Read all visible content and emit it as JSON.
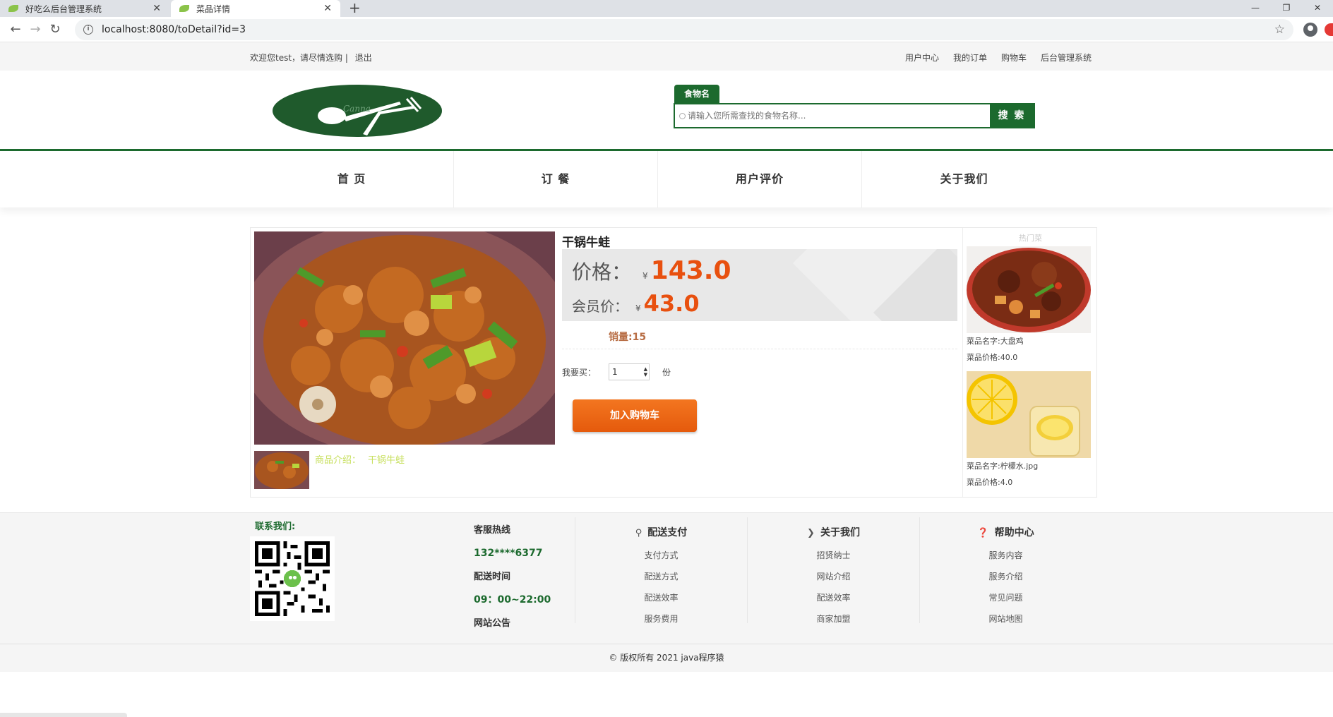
{
  "browser": {
    "tabs": [
      {
        "title": "好吃么后台管理系统",
        "active": false
      },
      {
        "title": "菜品详情",
        "active": true
      }
    ],
    "url": "localhost:8080/toDetail?id=3"
  },
  "topbar": {
    "welcome": "欢迎您test，请尽情选购 |",
    "logout": "退出",
    "links": [
      "用户中心",
      "我的订单",
      "购物车",
      "后台管理系统"
    ]
  },
  "search": {
    "tab_label": "食物名",
    "placeholder": "请输入您所需查找的食物名称...",
    "button": "搜 索"
  },
  "nav": [
    "首 页",
    "订 餐",
    "用户评价",
    "关于我们"
  ],
  "product": {
    "name": "干锅牛蛙",
    "price_label": "价格：",
    "currency": "¥",
    "price": "143.0",
    "member_label": "会员价：",
    "member_price": "43.0",
    "sales": "销量:15",
    "buy_label": "我要买：",
    "quantity": "1",
    "unit": "份",
    "add_to_cart": "加入购物车",
    "intro_label": "商品介绍：",
    "intro_text": "干锅牛蛙"
  },
  "hot": {
    "title": "热门菜",
    "items": [
      {
        "name": "菜品名字:大盘鸡",
        "price": "菜品价格:40.0"
      },
      {
        "name": "菜品名字:柠檬水.jpg",
        "price": "菜品价格:4.0"
      }
    ]
  },
  "footer": {
    "contact_title": "联系我们:",
    "hotline_label": "客服热线",
    "hotline": "132****6377",
    "time_label": "配送时间",
    "time": "09：00~22:00",
    "notice": "网站公告",
    "columns": [
      {
        "title": "配送支付",
        "icon": "bicycle-icon",
        "links": [
          "支付方式",
          "配送方式",
          "配送效率",
          "服务费用"
        ]
      },
      {
        "title": "关于我们",
        "icon": "chevron-down-icon",
        "links": [
          "招贤纳士",
          "网站介绍",
          "配送效率",
          "商家加盟"
        ]
      },
      {
        "title": "帮助中心",
        "icon": "help-icon",
        "links": [
          "服务内容",
          "服务介绍",
          "常见问题",
          "网站地图"
        ]
      }
    ],
    "copyright": "© 版权所有 2021   java程序猿"
  },
  "colors": {
    "brand_green": "#1c6a2e",
    "price_orange": "#e8500f",
    "cart_button": "#f07020"
  }
}
